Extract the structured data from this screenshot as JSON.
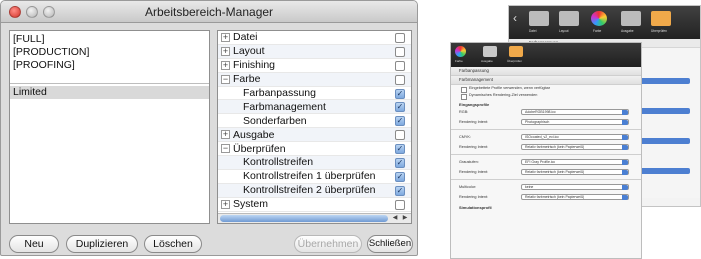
{
  "window": {
    "title": "Arbeitsbereich-Manager"
  },
  "workspaces": {
    "items": [
      "[FULL]",
      "[PRODUCTION]",
      "[PROOFING]",
      "Limited"
    ]
  },
  "menus": [
    {
      "label": "Datei",
      "level": 0,
      "toggle": "+",
      "checked": false
    },
    {
      "label": "Layout",
      "level": 0,
      "toggle": "+",
      "checked": false
    },
    {
      "label": "Finishing",
      "level": 0,
      "toggle": "+",
      "checked": false
    },
    {
      "label": "Farbe",
      "level": 0,
      "toggle": "−",
      "checked": false
    },
    {
      "label": "Farbanpassung",
      "level": 1,
      "checked": true
    },
    {
      "label": "Farbmanagement",
      "level": 1,
      "checked": true
    },
    {
      "label": "Sonderfarben",
      "level": 1,
      "checked": true
    },
    {
      "label": "Ausgabe",
      "level": 0,
      "toggle": "+",
      "checked": false
    },
    {
      "label": "Überprüfen",
      "level": 0,
      "toggle": "−",
      "checked": true
    },
    {
      "label": "Kontrollstreifen",
      "level": 1,
      "checked": true
    },
    {
      "label": "Kontrollstreifen 1 überprüfen",
      "level": 1,
      "checked": true
    },
    {
      "label": "Kontrollstreifen 2 überprüfen",
      "level": 1,
      "checked": true
    },
    {
      "label": "System",
      "level": 0,
      "toggle": "+",
      "checked": false
    }
  ],
  "buttons": {
    "new": "Neu",
    "duplicate": "Duplizieren",
    "delete": "Löschen",
    "apply": "Übernehmen",
    "close": "Schließen"
  },
  "preview_back": {
    "toolbar": [
      "Datei",
      "Layout",
      "Farbe",
      "Ausgabe",
      "Überprüfen"
    ],
    "section": "Farbanpassung"
  },
  "preview_front": {
    "toolbar": [
      "Farbe",
      "Ausgabe",
      "Überprüfen"
    ],
    "sections": [
      "Farbanpassung",
      "Farbmanagement"
    ],
    "checkboxes": [
      "Eingebettete Profile verwenden, wenn verfügbar",
      "Dynamisches Rendering-Ziel verwenden"
    ],
    "group_input": "Eingangsprofile",
    "group_sim": "Simulationsprofil",
    "profiles": [
      {
        "label": "RGB:",
        "value": "AdobeRGB1998.icc"
      },
      {
        "label": "Rendering Intent:",
        "value": "Photographisch"
      },
      {
        "label": "CMYK:",
        "value": "ISOcoated_v2_eci.icc"
      },
      {
        "label": "Rendering Intent:",
        "value": "Relativ farbmetrisch (kein Papierweiß)"
      },
      {
        "label": "Graustufen:",
        "value": "EFI Gray Profile.icc"
      },
      {
        "label": "Rendering Intent:",
        "value": "Relativ farbmetrisch (kein Papierweiß)"
      },
      {
        "label": "Multicolor:",
        "value": "keine"
      },
      {
        "label": "Rendering Intent:",
        "value": "Relativ farbmetrisch (kein Papierweiß)"
      }
    ]
  },
  "colors": {
    "accent": "#7ea9df",
    "toolbar_dark": "#2a2a2a"
  }
}
